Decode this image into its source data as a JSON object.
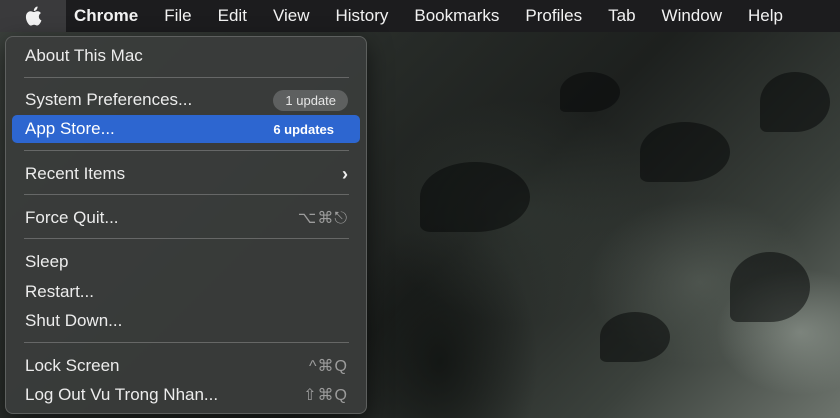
{
  "menubar": {
    "apple_icon": "apple-logo-icon",
    "items": [
      {
        "label": "Chrome"
      },
      {
        "label": "File"
      },
      {
        "label": "Edit"
      },
      {
        "label": "View"
      },
      {
        "label": "History"
      },
      {
        "label": "Bookmarks"
      },
      {
        "label": "Profiles"
      },
      {
        "label": "Tab"
      },
      {
        "label": "Window"
      },
      {
        "label": "Help"
      }
    ]
  },
  "apple_menu": {
    "items": {
      "about": {
        "label": "About This Mac"
      },
      "system_preferences": {
        "label": "System Preferences...",
        "badge": "1 update"
      },
      "app_store": {
        "label": "App Store...",
        "badge": "6 updates",
        "highlighted": true
      },
      "recent_items": {
        "label": "Recent Items",
        "submenu_icon": "chevron-right-icon"
      },
      "force_quit": {
        "label": "Force Quit...",
        "shortcut": "⌥⌘⎋"
      },
      "sleep": {
        "label": "Sleep"
      },
      "restart": {
        "label": "Restart..."
      },
      "shut_down": {
        "label": "Shut Down..."
      },
      "lock_screen": {
        "label": "Lock Screen",
        "shortcut": "^⌘Q"
      },
      "log_out": {
        "label": "Log Out Vu Trong Nhan...",
        "shortcut": "⇧⌘Q"
      }
    }
  },
  "colors": {
    "highlight": "#2d66d0",
    "menubar": "#1c1c1e",
    "menu_background": "#3a3c3b"
  }
}
